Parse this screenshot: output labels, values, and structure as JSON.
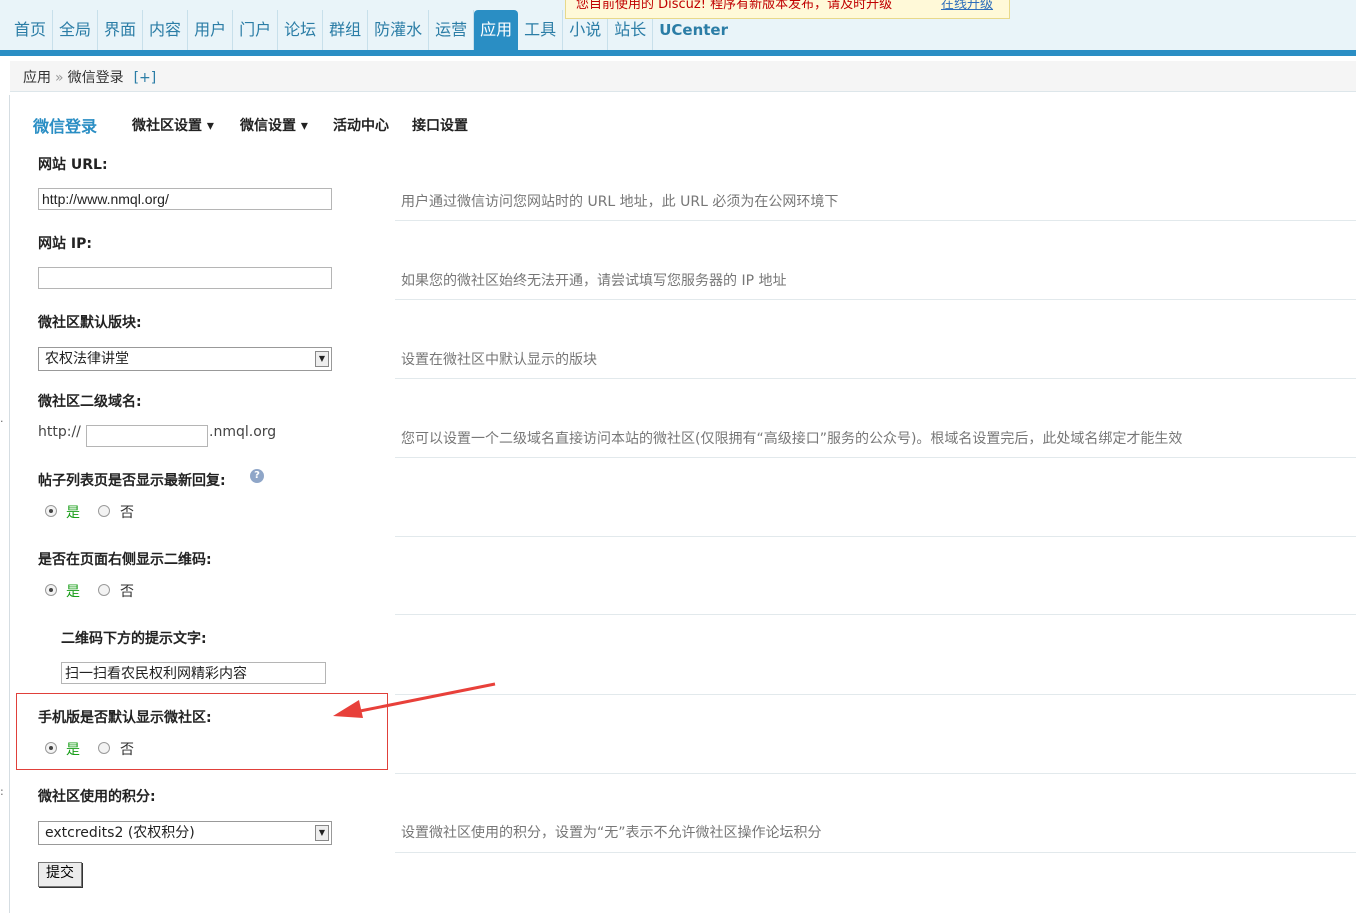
{
  "nav": {
    "items": [
      "首页",
      "全局",
      "界面",
      "内容",
      "用户",
      "门户",
      "论坛",
      "群组",
      "防灌水",
      "运营",
      "应用",
      "工具",
      "小说",
      "站长",
      "UCenter"
    ],
    "active_index": 10
  },
  "notice": {
    "message": "您目前使用的 Discuz! 程序有新版本发布，请及时升级",
    "link": "在线升级"
  },
  "breadcrumb": {
    "parent": "应用",
    "separator": "»",
    "current": "微信登录",
    "add": "[+]"
  },
  "subnav": {
    "title": "微信登录",
    "tabs": [
      "微社区设置 ▾",
      "微信设置 ▾",
      "活动中心",
      "接口设置"
    ]
  },
  "settings": {
    "site_url": {
      "label": "网站 URL:",
      "value": "http://www.nmql.org/",
      "desc": "用户通过微信访问您网站时的 URL 地址，此 URL 必须为在公网环境下"
    },
    "site_ip": {
      "label": "网站 IP:",
      "value": "",
      "desc": "如果您的微社区始终无法开通，请尝试填写您服务器的 IP 地址"
    },
    "default_board": {
      "label": "微社区默认版块:",
      "value": "农权法律讲堂",
      "desc": "设置在微社区中默认显示的版块"
    },
    "subdomain": {
      "label": "微社区二级域名:",
      "prefix": "http://",
      "value": "",
      "suffix": ".nmql.org",
      "desc": "您可以设置一个二级域名直接访问本站的微社区(仅限拥有“高级接口”服务的公众号)。根域名设置完后，此处域名绑定才能生效"
    },
    "show_latest_reply": {
      "label": "帖子列表页是否显示最新回复:",
      "help": "?",
      "yes": "是",
      "no": "否",
      "selected": "yes"
    },
    "show_qrcode": {
      "label": "是否在页面右侧显示二维码:",
      "yes": "是",
      "no": "否",
      "selected": "yes"
    },
    "qrcode_tip": {
      "label": "二维码下方的提示文字:",
      "value": "扫一扫看农民权利网精彩内容"
    },
    "mobile_default": {
      "label": "手机版是否默认显示微社区:",
      "yes": "是",
      "no": "否",
      "selected": "yes"
    },
    "credits": {
      "label": "微社区使用的积分:",
      "value": "extcredits2 (农权积分)",
      "desc": "设置微社区使用的积分，设置为“无”表示不允许微社区操作论坛积分"
    }
  },
  "submit_label": "提交",
  "accent_colors": {
    "nav_active": "#2a8ec4",
    "highlight_box": "#e0403a",
    "arrow": "#e8403a",
    "yes_text": "#1a9e1a"
  }
}
